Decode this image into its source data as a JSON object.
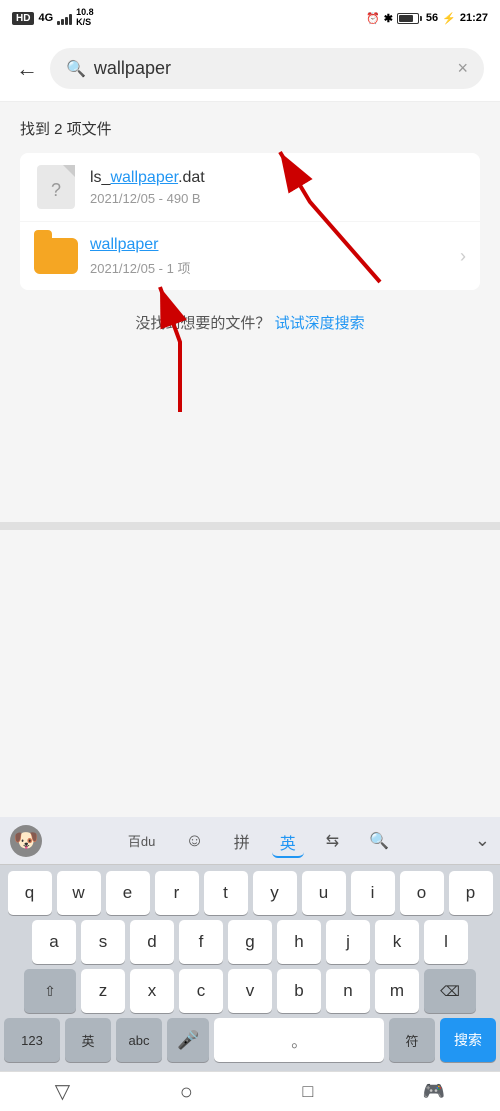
{
  "statusBar": {
    "left": {
      "hd": "HD",
      "network": "4G",
      "speed": "10.8\nK/S"
    },
    "right": {
      "time": "21:27",
      "battery": "56"
    }
  },
  "searchHeader": {
    "back_label": "←",
    "search_query": "wallpaper",
    "clear_label": "×"
  },
  "content": {
    "result_count": "找到 2 项文件",
    "files": [
      {
        "name_prefix": "ls_",
        "name_highlight": "wallpaper",
        "name_suffix": ".dat",
        "meta": "2021/12/05 - 490 B",
        "type": "dat"
      },
      {
        "name_highlight": "wallpaper",
        "name_suffix": "",
        "meta": "2021/12/05 - 1 项",
        "type": "folder"
      }
    ],
    "deep_search_text": "没找到想要的文件？",
    "deep_search_link": "试试深度搜索"
  },
  "keyboard": {
    "toolbar": {
      "items": [
        {
          "label": "百du",
          "active": false
        },
        {
          "label": "☺",
          "active": false
        },
        {
          "label": "拼",
          "active": false
        },
        {
          "label": "英",
          "active": true
        },
        {
          "label": "⇆",
          "active": false
        },
        {
          "label": "🔍",
          "active": false
        }
      ],
      "collapse_label": "⌄"
    },
    "rows": [
      [
        "q",
        "w",
        "e",
        "r",
        "t",
        "y",
        "u",
        "i",
        "o",
        "p"
      ],
      [
        "a",
        "s",
        "d",
        "f",
        "g",
        "h",
        "j",
        "k",
        "l"
      ],
      [
        "⇧",
        "z",
        "x",
        "c",
        "v",
        "b",
        "n",
        "m",
        "⌫"
      ],
      [
        "123",
        "英",
        "abc",
        "🎤",
        "。",
        "符",
        "搜索"
      ]
    ]
  },
  "bottomNav": {
    "back": "▽",
    "home": "○",
    "recents": "□",
    "game_icon": "🎮"
  }
}
